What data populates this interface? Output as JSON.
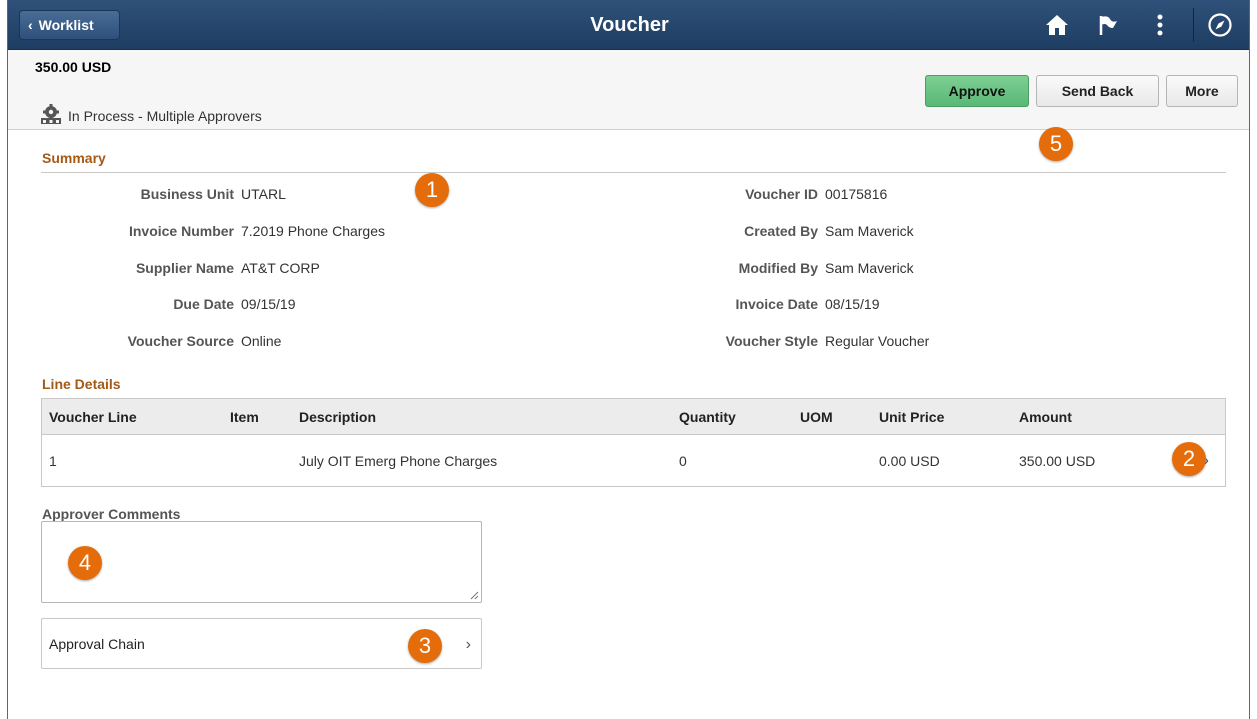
{
  "banner": {
    "back_label": "Worklist",
    "title": "Voucher"
  },
  "header": {
    "amount": "350.00  USD",
    "status": "In Process - Multiple Approvers",
    "approve_label": "Approve",
    "send_back_label": "Send Back",
    "more_label": "More"
  },
  "summary": {
    "title": "Summary",
    "left": [
      {
        "label": "Business Unit",
        "value": "UTARL"
      },
      {
        "label": "Invoice Number",
        "value": "7.2019 Phone Charges"
      },
      {
        "label": "Supplier Name",
        "value": "AT&T CORP"
      },
      {
        "label": "Due Date",
        "value": "09/15/19"
      },
      {
        "label": "Voucher Source",
        "value": "Online"
      }
    ],
    "right": [
      {
        "label": "Voucher ID",
        "value": "00175816"
      },
      {
        "label": "Created By",
        "value": "Sam Maverick"
      },
      {
        "label": "Modified By",
        "value": "Sam Maverick"
      },
      {
        "label": "Invoice Date",
        "value": "08/15/19"
      },
      {
        "label": "Voucher Style",
        "value": "Regular Voucher"
      }
    ]
  },
  "line_details": {
    "title": "Line Details",
    "columns": [
      "Voucher Line",
      "Item",
      "Description",
      "Quantity",
      "UOM",
      "Unit Price",
      "Amount"
    ],
    "rows": [
      [
        "1",
        "",
        "July OIT Emerg Phone Charges",
        "0",
        "",
        "0.00 USD",
        "350.00 USD"
      ]
    ]
  },
  "comments": {
    "label": "Approver Comments",
    "value": ""
  },
  "approval_chain": {
    "label": "Approval Chain"
  },
  "callouts": [
    "1",
    "2",
    "3",
    "4",
    "5"
  ],
  "colors": {
    "banner": "#2a4a70",
    "approve": "#6cc585",
    "section_title": "#a45a16",
    "callout": "#e46c0a"
  }
}
